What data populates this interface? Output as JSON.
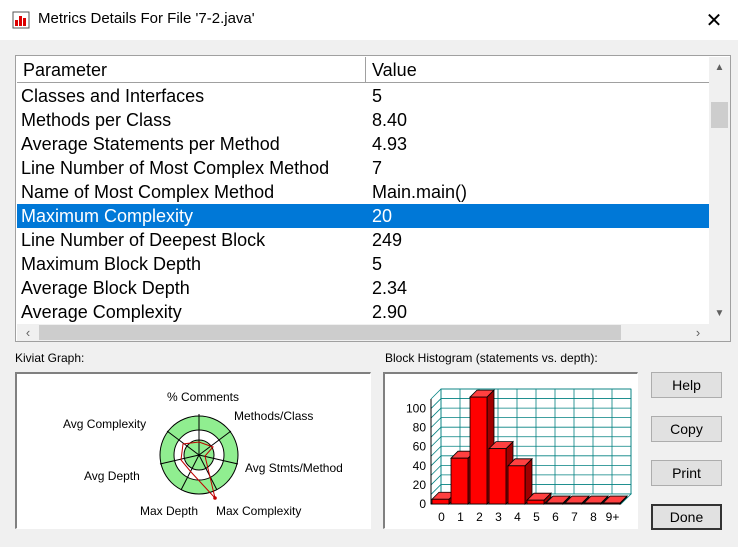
{
  "window": {
    "title": "Metrics Details For File '7-2.java'"
  },
  "table": {
    "headers": [
      "Parameter",
      "Value"
    ],
    "rows": [
      [
        "Classes and Interfaces",
        "5"
      ],
      [
        "Methods per Class",
        "8.40"
      ],
      [
        "Average Statements per Method",
        "4.93"
      ],
      [
        "Line Number of Most Complex Method",
        "7"
      ],
      [
        "Name of Most Complex Method",
        "Main.main()"
      ],
      [
        "Maximum Complexity",
        "20"
      ],
      [
        "Line Number of Deepest Block",
        "249"
      ],
      [
        "Maximum Block Depth",
        "5"
      ],
      [
        "Average Block Depth",
        "2.34"
      ],
      [
        "Average Complexity",
        "2.90"
      ]
    ],
    "selected_row": 5
  },
  "kiviat": {
    "label": "Kiviat Graph:",
    "axes": [
      "% Comments",
      "Methods/Class",
      "Avg Stmts/Method",
      "Max Complexity",
      "Max Depth",
      "Avg Depth",
      "Avg Complexity"
    ]
  },
  "histogram": {
    "label": "Block Histogram (statements vs. depth):"
  },
  "chart_data": {
    "type": "bar",
    "title": "Block Histogram (statements vs. depth):",
    "categories": [
      "0",
      "1",
      "2",
      "3",
      "4",
      "5",
      "6",
      "7",
      "8",
      "9+"
    ],
    "values": [
      5,
      48,
      112,
      58,
      40,
      4,
      1,
      1,
      1,
      1
    ],
    "yticks": [
      0,
      20,
      40,
      60,
      80,
      100
    ],
    "ylim": [
      0,
      110
    ],
    "grid": true,
    "bar_color": "#ff0000"
  },
  "buttons": {
    "help": "Help",
    "copy": "Copy",
    "print": "Print",
    "done": "Done"
  },
  "colors": {
    "selection": "#0078d7",
    "bar": "#ff0000",
    "grid": "#008080",
    "kiviat_ring": "#90ee90"
  }
}
